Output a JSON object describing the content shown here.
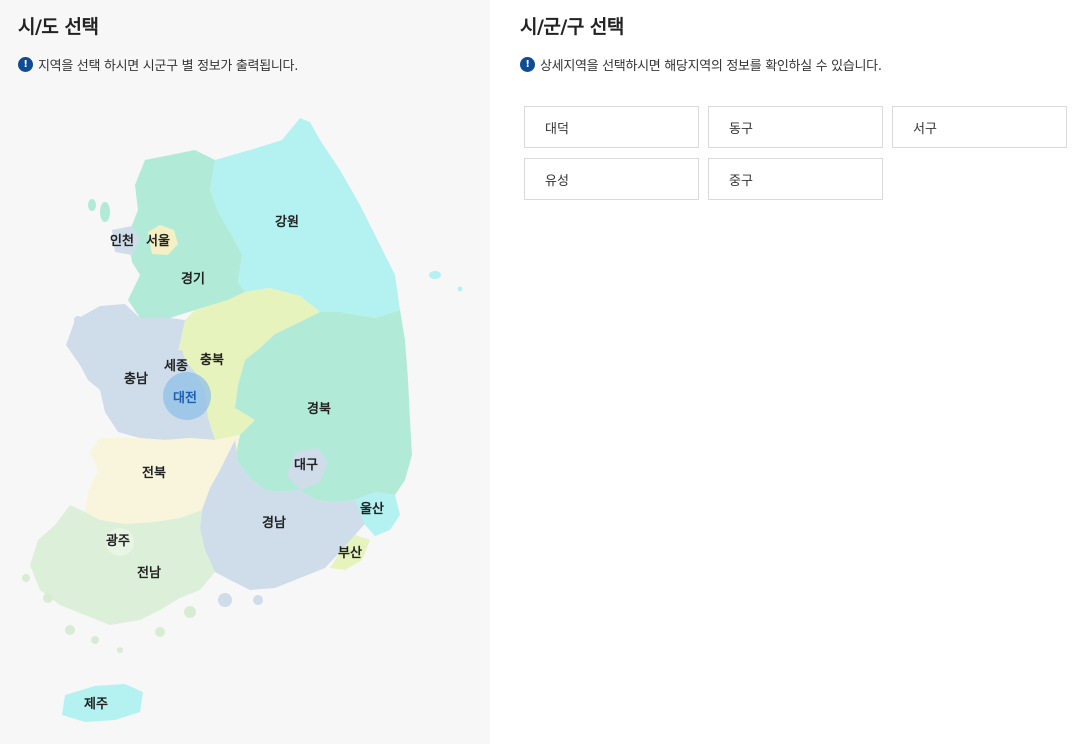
{
  "left": {
    "title": "시/도 선택",
    "notice": "지역을 선택 하시면 시군구 별 정보가 출력됩니다.",
    "notice_icon": "info-icon"
  },
  "right": {
    "title": "시/군/구 선택",
    "notice": "상세지역을 선택하시면 해당지역의 정보를 확인하실 수 있습니다.",
    "notice_icon": "info-icon"
  },
  "regions": {
    "incheon": "인천",
    "seoul": "서울",
    "gyeonggi": "경기",
    "gangwon": "강원",
    "chungnam": "충남",
    "sejong": "세종",
    "chungbuk": "충북",
    "daejeon": "대전",
    "gyeongbuk": "경북",
    "daegu": "대구",
    "jeonbuk": "전북",
    "ulsan": "울산",
    "gyeongnam": "경남",
    "busan": "부산",
    "gwangju": "광주",
    "jeonnam": "전남",
    "jeju": "제주"
  },
  "selected_region": "대전",
  "colors": {
    "accent": "#0f4c96",
    "selected_text": "#1a5fb4",
    "gangwon": "#b4f2f2",
    "gyeonggi": "#b2ead8",
    "chungbuk": "#e6f3bc",
    "chungnam": "#cfdcea",
    "gyeongbuk": "#b2ead8",
    "jeonbuk": "#f9f5dc",
    "gyeongnam": "#cfdcea",
    "jeonnam": "#dcefd8",
    "jeju": "#b4f2f2"
  },
  "districts": [
    "대덕",
    "동구",
    "서구",
    "유성",
    "중구"
  ]
}
